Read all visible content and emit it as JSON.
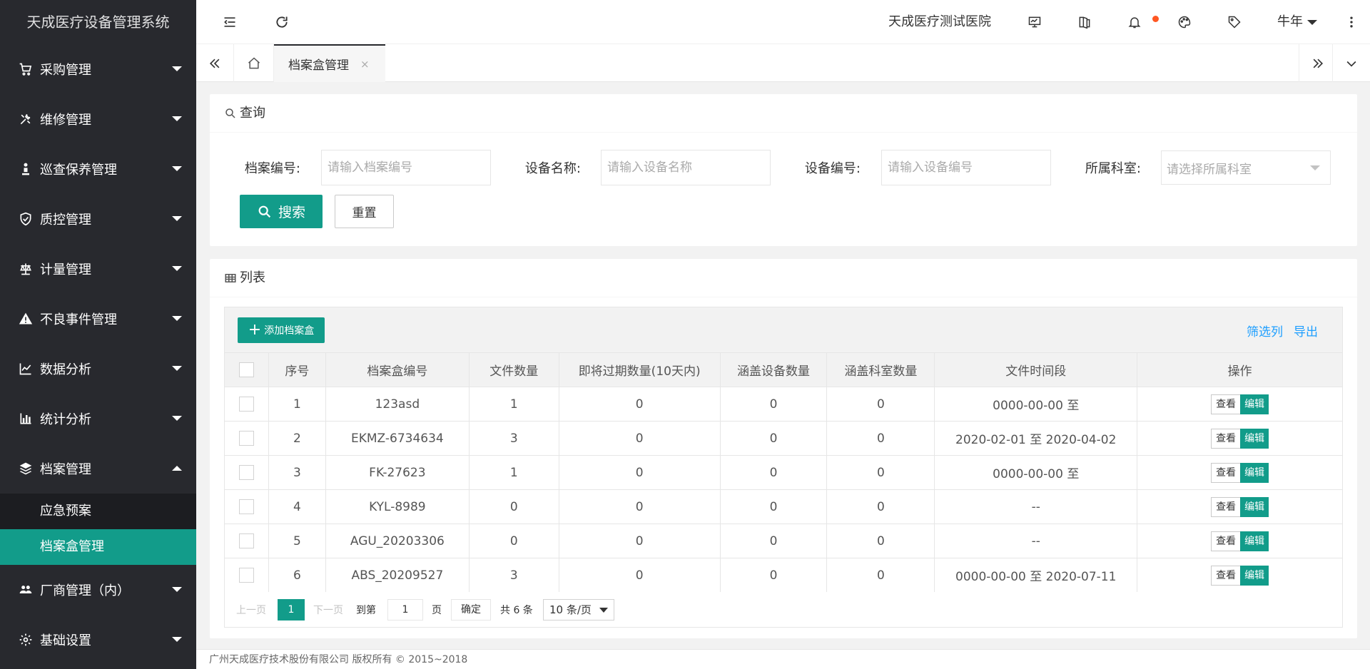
{
  "app_title": "天成医疗设备管理系统",
  "sidebar": {
    "items": [
      {
        "label": "采购管理",
        "icon": "cart-icon"
      },
      {
        "label": "维修管理",
        "icon": "wrench-icon"
      },
      {
        "label": "巡查保养管理",
        "icon": "person-icon"
      },
      {
        "label": "质控管理",
        "icon": "shield-icon"
      },
      {
        "label": "计量管理",
        "icon": "scale-icon"
      },
      {
        "label": "不良事件管理",
        "icon": "warning-icon"
      },
      {
        "label": "数据分析",
        "icon": "line-chart-icon"
      },
      {
        "label": "统计分析",
        "icon": "bar-chart-icon"
      },
      {
        "label": "档案管理",
        "icon": "layers-icon"
      }
    ],
    "archive_sub": [
      "应急预案",
      "档案盒管理"
    ],
    "bottom_items": [
      {
        "label": "厂商管理（内）",
        "icon": "users-icon"
      },
      {
        "label": "基础设置",
        "icon": "gear-icon"
      }
    ]
  },
  "header": {
    "hospital": "天成医疗测试医院",
    "user": "牛年"
  },
  "tabs": {
    "active_label": "档案盒管理",
    "close": "×"
  },
  "query": {
    "title": "查询",
    "fields": [
      {
        "label": "档案编号:",
        "placeholder": "请输入档案编号"
      },
      {
        "label": "设备名称:",
        "placeholder": "请输入设备名称"
      },
      {
        "label": "设备编号:",
        "placeholder": "请输入设备编号"
      },
      {
        "label": "所属科室:",
        "placeholder": "请选择所属科室"
      }
    ],
    "search_label": "搜索",
    "reset_label": "重置"
  },
  "list": {
    "title": "列表",
    "add_label": "添加档案盒",
    "filter_cols_label": "筛选列",
    "export_label": "导出",
    "columns": [
      "序号",
      "档案盒编号",
      "文件数量",
      "即将过期数量(10天内)",
      "涵盖设备数量",
      "涵盖科室数量",
      "文件时间段",
      "操作"
    ],
    "rows": [
      {
        "no": "1",
        "code": "123asd",
        "files": "1",
        "expiring": "0",
        "devices": "0",
        "depts": "0",
        "period": "0000-00-00 至"
      },
      {
        "no": "2",
        "code": "EKMZ-6734634",
        "files": "3",
        "expiring": "0",
        "devices": "0",
        "depts": "0",
        "period": "2020-02-01 至 2020-04-02"
      },
      {
        "no": "3",
        "code": "FK-27623",
        "files": "1",
        "expiring": "0",
        "devices": "0",
        "depts": "0",
        "period": "0000-00-00 至"
      },
      {
        "no": "4",
        "code": "KYL-8989",
        "files": "0",
        "expiring": "0",
        "devices": "0",
        "depts": "0",
        "period": "--"
      },
      {
        "no": "5",
        "code": "AGU_20203306",
        "files": "0",
        "expiring": "0",
        "devices": "0",
        "depts": "0",
        "period": "--"
      },
      {
        "no": "6",
        "code": "ABS_20209527",
        "files": "3",
        "expiring": "0",
        "devices": "0",
        "depts": "0",
        "period": "0000-00-00 至 2020-07-11"
      }
    ],
    "view_label": "查看",
    "edit_label": "编辑"
  },
  "pagination": {
    "prev": "上一页",
    "current": "1",
    "next": "下一页",
    "goto": "到第",
    "goto_value": "1",
    "page_unit": "页",
    "confirm": "确定",
    "total": "共 6 条",
    "page_size": "10 条/页"
  },
  "footer": "广州天成医疗技术股份有限公司 版权所有 © 2015~2018",
  "colors": {
    "accent": "#129c8a",
    "sidebar_bg": "#28292e",
    "link": "#1E9FFF",
    "notice_dot": "#ff5722"
  }
}
